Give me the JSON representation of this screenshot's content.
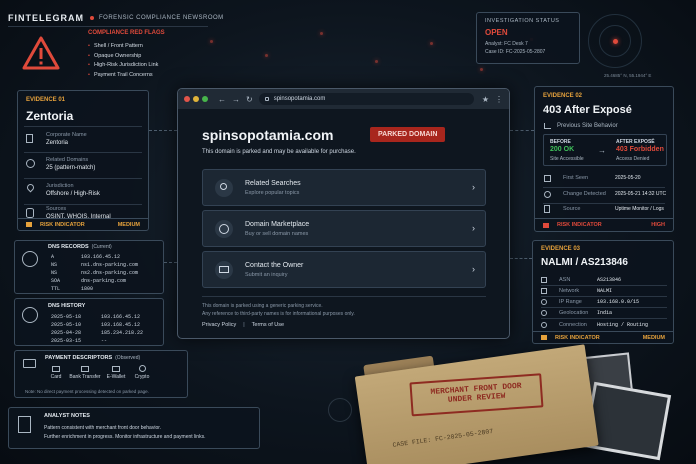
{
  "brand": {
    "name": "FINTELEGRAM",
    "section": "FORENSIC COMPLIANCE NEWSROOM"
  },
  "red_flags": {
    "title": "COMPLIANCE RED FLAGS",
    "items": [
      "Shell / Front Pattern",
      "Opaque Ownership",
      "High-Risk Jurisdiction Link",
      "Payment Trail Concerns"
    ]
  },
  "investigation": {
    "title": "INVESTIGATION STATUS",
    "status": "OPEN",
    "analyst": "Analyst: FC Desk 7",
    "case_id": "Case ID: FC-2025-05-2807"
  },
  "coords": "25.4685° N, 55.1944° E",
  "evidence1": {
    "tag": "EVIDENCE 01",
    "name": "Zentoria",
    "rows": [
      {
        "label": "Corporate Name",
        "value": "Zentoria"
      },
      {
        "label": "Related Domains",
        "value": "25 (pattern-match)"
      },
      {
        "label": "Jurisdiction",
        "value": "Offshore / High-Risk"
      },
      {
        "label": "Sources",
        "value": "OSINT, WHOIS, Internal"
      }
    ],
    "risk_label": "RISK INDICATOR",
    "risk_level": "MEDIUM"
  },
  "browser": {
    "url": "spinsopotamia.com",
    "domain": "spinsopotamia.com",
    "badge": "PARKED DOMAIN",
    "subtitle": "This domain is parked and may be available for purchase.",
    "cards": [
      {
        "title": "Related Searches",
        "sub": "Explore popular topics"
      },
      {
        "title": "Domain Marketplace",
        "sub": "Buy or sell domain names"
      },
      {
        "title": "Contact the Owner",
        "sub": "Submit an inquiry"
      }
    ],
    "footer1": "This domain is parked using a generic parking service.",
    "footer2": "Any reference to third-party names is for informational purposes only.",
    "privacy": "Privacy Policy",
    "divider": "|",
    "terms": "Terms of Use"
  },
  "evidence2": {
    "tag": "EVIDENCE 02",
    "title": "403 After Exposé",
    "sub": "Previous Site Behavior",
    "before_label": "BEFORE",
    "before_code": "200 OK",
    "before_desc": "Site Accessible",
    "after_label": "AFTER EXPOSÉ",
    "after_code": "403 Forbidden",
    "after_desc": "Access Denied",
    "rows": [
      {
        "label": "First Seen",
        "value": "2025-05-20"
      },
      {
        "label": "Change Detected",
        "value": "2025-05-21 14:32 UTC"
      },
      {
        "label": "Source",
        "value": "Uptime Monitor / Logs"
      }
    ],
    "risk_label": "RISK INDICATOR",
    "risk_level": "HIGH"
  },
  "dns": {
    "title": "DNS RECORDS",
    "title_note": "(Current)",
    "records": [
      {
        "type": "A",
        "value": "103.166.45.12"
      },
      {
        "type": "NS",
        "value": "ns1.dns-parking.com"
      },
      {
        "type": "NS",
        "value": "ns2.dns-parking.com"
      },
      {
        "type": "SOA",
        "value": "dns-parking.com"
      },
      {
        "type": "TTL",
        "value": "1800"
      }
    ]
  },
  "dns_history": {
    "title": "DNS HISTORY",
    "rows": [
      {
        "date": "2025-05-18",
        "ip": "103.166.45.12"
      },
      {
        "date": "2025-05-10",
        "ip": "103.168.45.12"
      },
      {
        "date": "2025-04-28",
        "ip": "185.234.218.22"
      },
      {
        "date": "2025-03-15",
        "ip": "--"
      }
    ]
  },
  "evidence3": {
    "tag": "EVIDENCE 03",
    "title": "NALMI / AS213846",
    "rows": [
      {
        "label": "ASN",
        "value": "AS213846"
      },
      {
        "label": "Network",
        "value": "NALMI"
      },
      {
        "label": "IP Range",
        "value": "103.168.0.0/15"
      },
      {
        "label": "Geolocation",
        "value": "India"
      },
      {
        "label": "Connection",
        "value": "Hosting / Routing"
      }
    ],
    "risk_label": "RISK INDICATOR",
    "risk_level": "MEDIUM"
  },
  "payment": {
    "title": "PAYMENT DESCRIPTORS",
    "title_note": "(Observed)",
    "methods": [
      "Card",
      "Bank Transfer",
      "E-Wallet",
      "Crypto"
    ],
    "note": "Note: No direct payment processing detected on parked page."
  },
  "analyst": {
    "title": "ANALYST NOTES",
    "line1": "Pattern consistent with merchant front door behavior.",
    "line2": "Further enrichment in progress. Monitor infrastructure and payment links."
  },
  "folder": {
    "stamp_line1": "MERCHANT FRONT DOOR",
    "stamp_line2": "UNDER REVIEW",
    "case_file": "CASE FILE: FC-2025-05-2807"
  },
  "colors": {
    "accent": "#e6a23c",
    "alert": "#e04a3b",
    "ok": "#3fbf5a",
    "panel": "#0c141d"
  }
}
